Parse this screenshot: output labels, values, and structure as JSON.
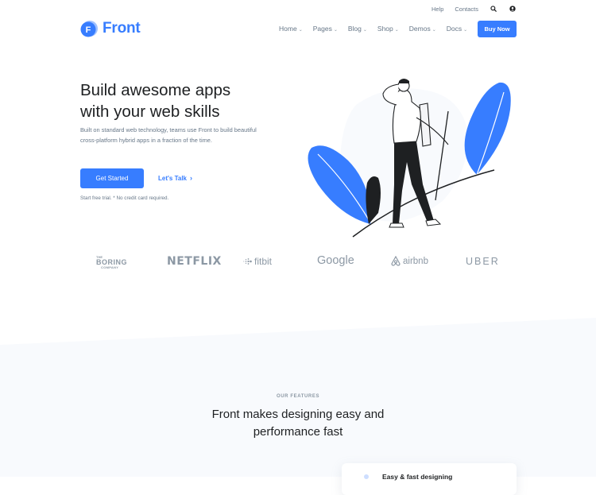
{
  "topbar": {
    "help": "Help",
    "contacts": "Contacts"
  },
  "brand": {
    "name": "Front",
    "mark_letter": "F",
    "accent": "#377dff"
  },
  "nav": {
    "items": [
      {
        "label": "Home"
      },
      {
        "label": "Pages"
      },
      {
        "label": "Blog"
      },
      {
        "label": "Shop"
      },
      {
        "label": "Demos"
      },
      {
        "label": "Docs"
      }
    ],
    "buy_label": "Buy Now"
  },
  "hero": {
    "title_line1": "Build awesome apps",
    "title_line2": "with your web skills",
    "description": "Built on standard web technology, teams use Front to build beautiful cross-platform hybrid apps in a fraction of the time.",
    "primary_cta": "Get Started",
    "secondary_cta": "Let's Talk",
    "note": "Start free trial. * No credit card required."
  },
  "clients": {
    "boring_line1": "THE",
    "boring_line2": "BORING",
    "boring_line3": "COMPANY",
    "netflix": "NETFLIX",
    "fitbit": "fitbit",
    "google": "Google",
    "airbnb": "airbnb",
    "uber": "UBER"
  },
  "features": {
    "eyebrow": "OUR FEATURES",
    "title_line1": "Front makes designing easy and",
    "title_line2": "performance fast",
    "first_card": "Easy & fast designing"
  },
  "icons": {
    "search": "search-icon",
    "account": "user-icon"
  }
}
